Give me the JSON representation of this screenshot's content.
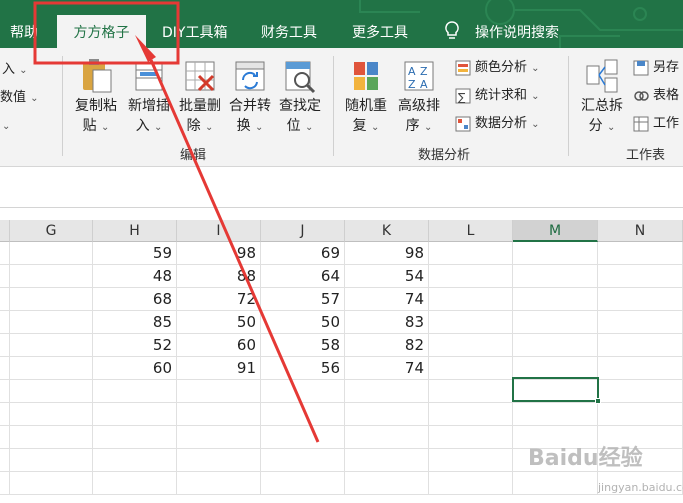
{
  "tabs": {
    "help": "帮助",
    "fangfang": "方方格子",
    "diy": "DIY工具箱",
    "finance": "财务工具",
    "more": "更多工具",
    "tell_me": "操作说明搜索"
  },
  "ribbon": {
    "left_partial": {
      "item1": "入",
      "item2": "数值"
    },
    "copy_paste": {
      "line1": "复制粘",
      "line2": "贴"
    },
    "new_insert": {
      "line1": "新增插",
      "line2": "入"
    },
    "batch_delete": {
      "line1": "批量删",
      "line2": "除"
    },
    "merge_convert": {
      "line1": "合并转",
      "line2": "换"
    },
    "find_locate": {
      "line1": "查找定",
      "line2": "位"
    },
    "group_edit": "编辑",
    "random_repeat": {
      "line1": "随机重",
      "line2": "复"
    },
    "advanced_sort": {
      "line1": "高级排",
      "line2": "序"
    },
    "color_analysis": "颜色分析",
    "stats_sum": "统计求和",
    "data_analysis": "数据分析",
    "group_data_analysis": "数据分析",
    "summary_split": {
      "line1": "汇总拆",
      "line2": "分"
    },
    "save_as": "另存",
    "table": "表格",
    "work": "工作",
    "group_worksheet": "工作表"
  },
  "columns": [
    "G",
    "H",
    "I",
    "J",
    "K",
    "L",
    "M",
    "N"
  ],
  "rows": [
    [
      59,
      98,
      69,
      98
    ],
    [
      48,
      88,
      64,
      54
    ],
    [
      68,
      72,
      57,
      74
    ],
    [
      85,
      50,
      50,
      83
    ],
    [
      52,
      60,
      58,
      82
    ],
    [
      60,
      91,
      56,
      74
    ]
  ],
  "colors": {
    "excel_green": "#217346",
    "annotation_red": "#e53935"
  },
  "watermark": {
    "brand": "Baidu经验",
    "url": "jingyan.baidu.com"
  }
}
